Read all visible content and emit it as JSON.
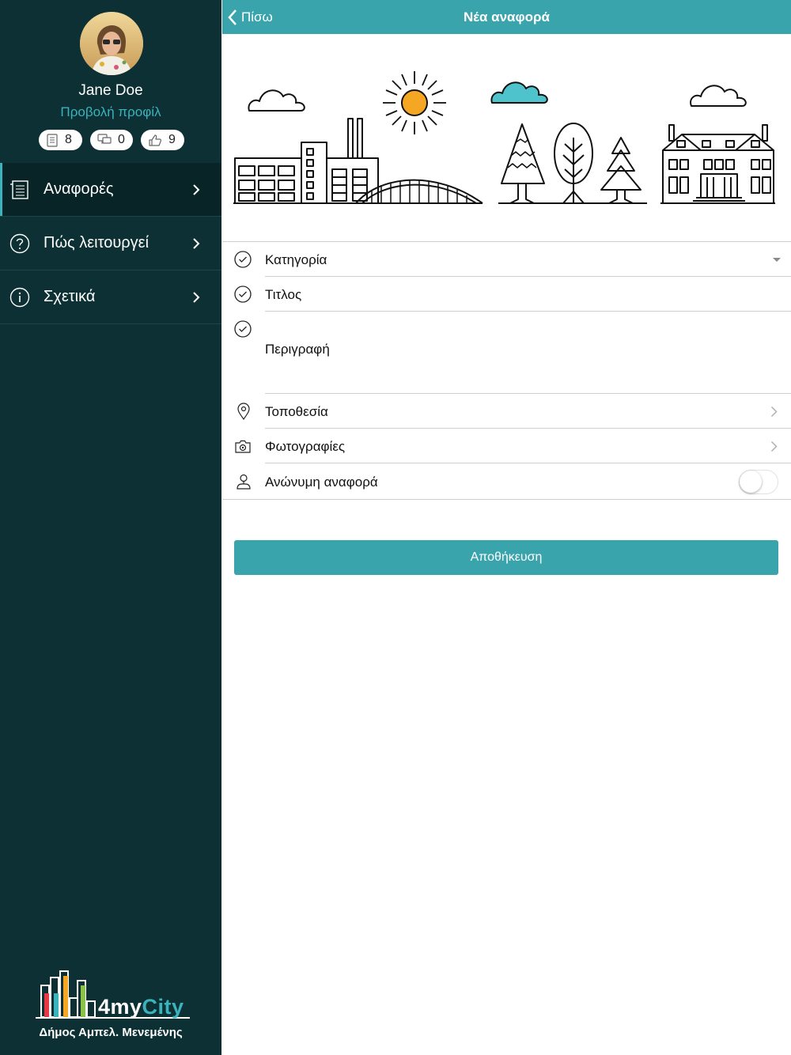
{
  "profile": {
    "name": "Jane Doe",
    "view_profile_link": "Προβολή προφίλ",
    "stats": [
      {
        "icon": "document-icon",
        "value": "8"
      },
      {
        "icon": "comments-icon",
        "value": "0"
      },
      {
        "icon": "thumbs-up-icon",
        "value": "9"
      }
    ]
  },
  "menu": {
    "items": [
      {
        "label": "Αναφορές",
        "icon": "reports-icon",
        "active": true
      },
      {
        "label": "Πώς λειτουργεί",
        "icon": "help-icon",
        "active": false
      },
      {
        "label": "Σχετικά",
        "icon": "info-icon",
        "active": false
      }
    ]
  },
  "logo": {
    "brand_prefix": "4my",
    "brand_suffix": "City",
    "municipality": "Δήμος Αμπελ. Μενεμένης"
  },
  "header": {
    "back_label": "Πίσω",
    "title": "Νέα αναφορά"
  },
  "form": {
    "category_label": "Κατηγορία",
    "title_label": "Τιτλος",
    "description_label": "Περιγραφή",
    "location_label": "Τοποθεσία",
    "photos_label": "Φωτογραφίες",
    "anonymous_label": "Ανώνυμη αναφορά",
    "anonymous_enabled": false
  },
  "actions": {
    "save_label": "Αποθήκευση"
  },
  "colors": {
    "sidebar_bg": "#0c3033",
    "accent": "#3aa4ad",
    "link": "#3ab3bd",
    "sun": "#f5a623"
  }
}
